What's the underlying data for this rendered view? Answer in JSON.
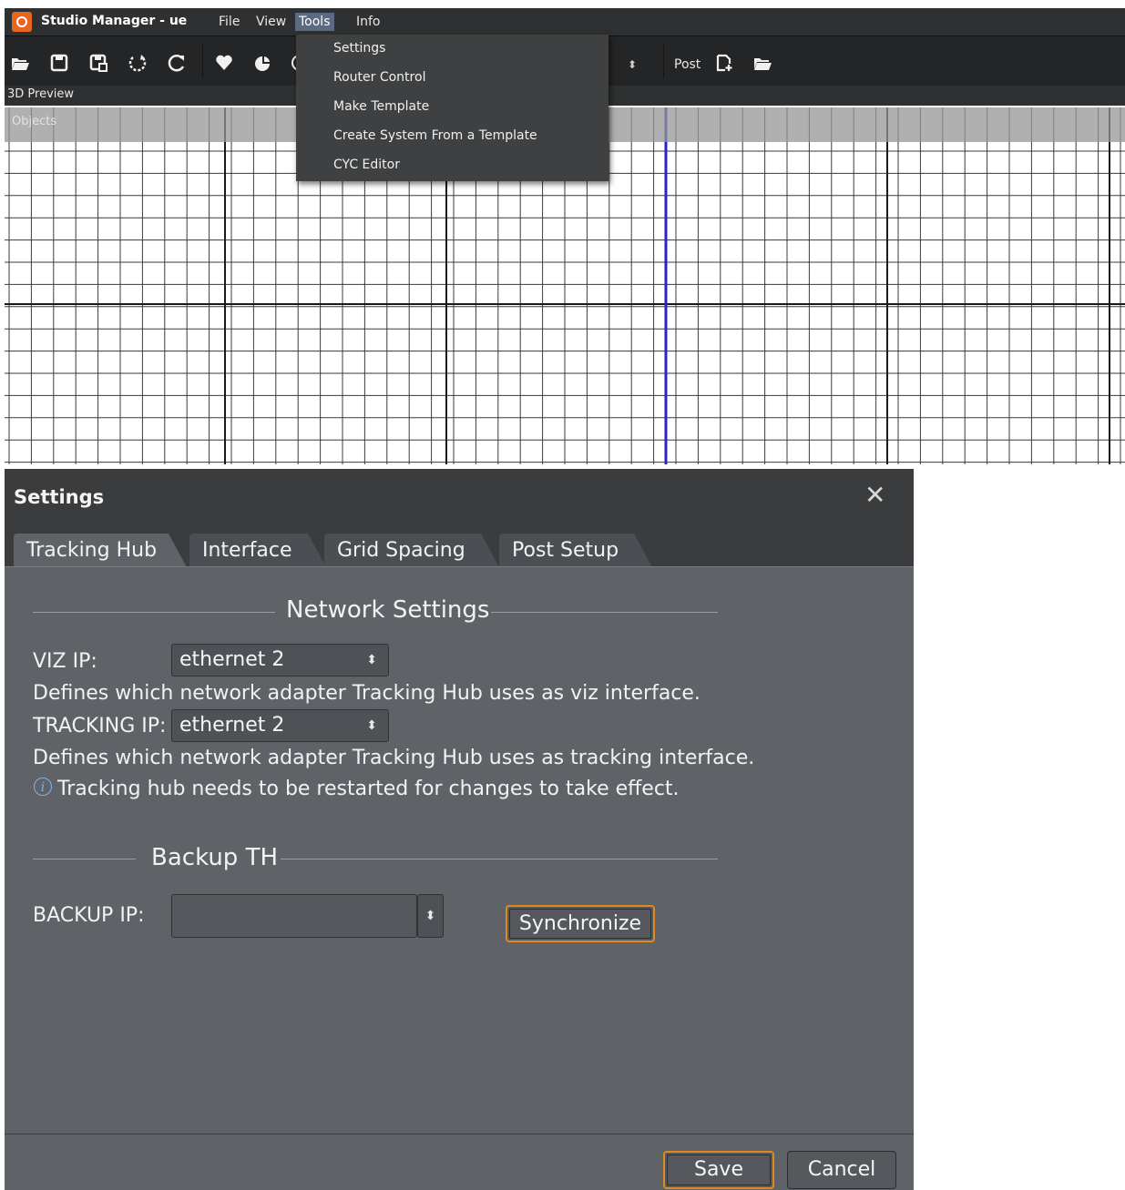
{
  "window": {
    "title": "Studio Manager - ue",
    "menu": [
      "File",
      "View",
      "Tools",
      "Info"
    ],
    "active_menu": "Tools"
  },
  "toolbar": {
    "icons": [
      "open-folder-icon",
      "save-icon",
      "save-as-icon",
      "undo-icon",
      "refresh-icon",
      "heart-icon",
      "pie-icon"
    ],
    "post_label": "Post",
    "post_icons": [
      "new-file-icon",
      "open-folder-icon"
    ]
  },
  "preview": {
    "title": "3D Preview",
    "objects_label": "Objects"
  },
  "tools_menu": {
    "items": [
      "Settings",
      "Router Control",
      "Make Template",
      "Create System From a Template",
      "CYC Editor"
    ]
  },
  "dialog": {
    "title": "Settings",
    "close_glyph": "✕",
    "tabs": [
      "Tracking Hub",
      "Interface",
      "Grid Spacing",
      "Post Setup"
    ],
    "active_tab": "Tracking Hub",
    "network": {
      "heading": "Network Settings",
      "viz_ip_label": "VIZ IP:",
      "viz_ip_value": "ethernet 2",
      "viz_desc": "Defines which network adapter Tracking Hub uses as viz interface.",
      "tracking_ip_label": "TRACKING IP:",
      "tracking_ip_value": "ethernet 2",
      "tracking_desc": "Defines which network adapter Tracking Hub uses as tracking interface.",
      "info_glyph": "i",
      "info_text": "Tracking hub needs to be restarted for changes to take effect."
    },
    "backup": {
      "heading": "Backup TH",
      "ip_label": "BACKUP IP:",
      "ip_value": "",
      "sync_button": "Synchronize"
    },
    "footer": {
      "save": "Save",
      "cancel": "Cancel"
    }
  },
  "colors": {
    "accent": "#e08a1e",
    "logo": "#e8661e",
    "grid_minor": "#3a3a3a",
    "grid_major": "#1a1a1a",
    "grid_highlight": "#2424c8",
    "info": "#7fb2e8"
  }
}
